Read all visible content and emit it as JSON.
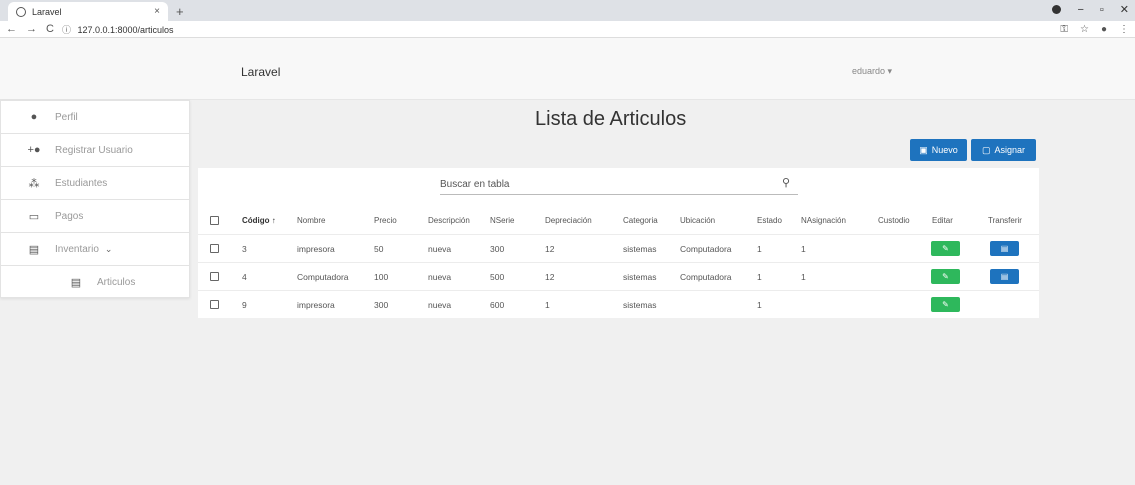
{
  "browser": {
    "tab_title": "Laravel",
    "tab_close": "×",
    "new_tab": "+",
    "url": "127.0.0.1:8000/articulos"
  },
  "header": {
    "brand": "Laravel",
    "user": "eduardo ▾"
  },
  "sidebar": {
    "items": [
      {
        "label": "Perfil",
        "icon": "user-icon"
      },
      {
        "label": "Registrar Usuario",
        "icon": "add-user-icon"
      },
      {
        "label": "Estudiantes",
        "icon": "group-icon"
      },
      {
        "label": "Pagos",
        "icon": "card-icon"
      },
      {
        "label": "Inventario",
        "icon": "clipboard-icon"
      },
      {
        "label": "Articulos",
        "icon": "clipboard-icon"
      }
    ]
  },
  "main": {
    "title": "Lista de Articulos",
    "nuevo_label": "Nuevo",
    "asignar_label": "Asignar",
    "search_placeholder": "Buscar en tabla"
  },
  "table": {
    "headers": {
      "codigo": "Código",
      "nombre": "Nombre",
      "precio": "Precio",
      "descripcion": "Descripción",
      "nserie": "NSerie",
      "depreciacion": "Depreciación",
      "categoria": "Categoria",
      "ubicacion": "Ubicación",
      "estado": "Estado",
      "nasignacion": "NAsignación",
      "custodio": "Custodio",
      "editar": "Editar",
      "transferir": "Transferir"
    },
    "rows": [
      {
        "codigo": "3",
        "nombre": "impresora",
        "precio": "50",
        "descripcion": "nueva",
        "nserie": "300",
        "depreciacion": "12",
        "categoria": "sistemas",
        "ubicacion": "Computadora",
        "estado": "1",
        "nasignacion": "1",
        "custodio": ""
      },
      {
        "codigo": "4",
        "nombre": "Computadora",
        "precio": "100",
        "descripcion": "nueva",
        "nserie": "500",
        "depreciacion": "12",
        "categoria": "sistemas",
        "ubicacion": "Computadora",
        "estado": "1",
        "nasignacion": "1",
        "custodio": ""
      },
      {
        "codigo": "9",
        "nombre": "impresora",
        "precio": "300",
        "descripcion": "nueva",
        "nserie": "600",
        "depreciacion": "1",
        "categoria": "sistemas",
        "ubicacion": "",
        "estado": "1",
        "nasignacion": "",
        "custodio": ""
      }
    ]
  },
  "colors": {
    "primary": "#1e73be",
    "success": "#2eb85c"
  }
}
